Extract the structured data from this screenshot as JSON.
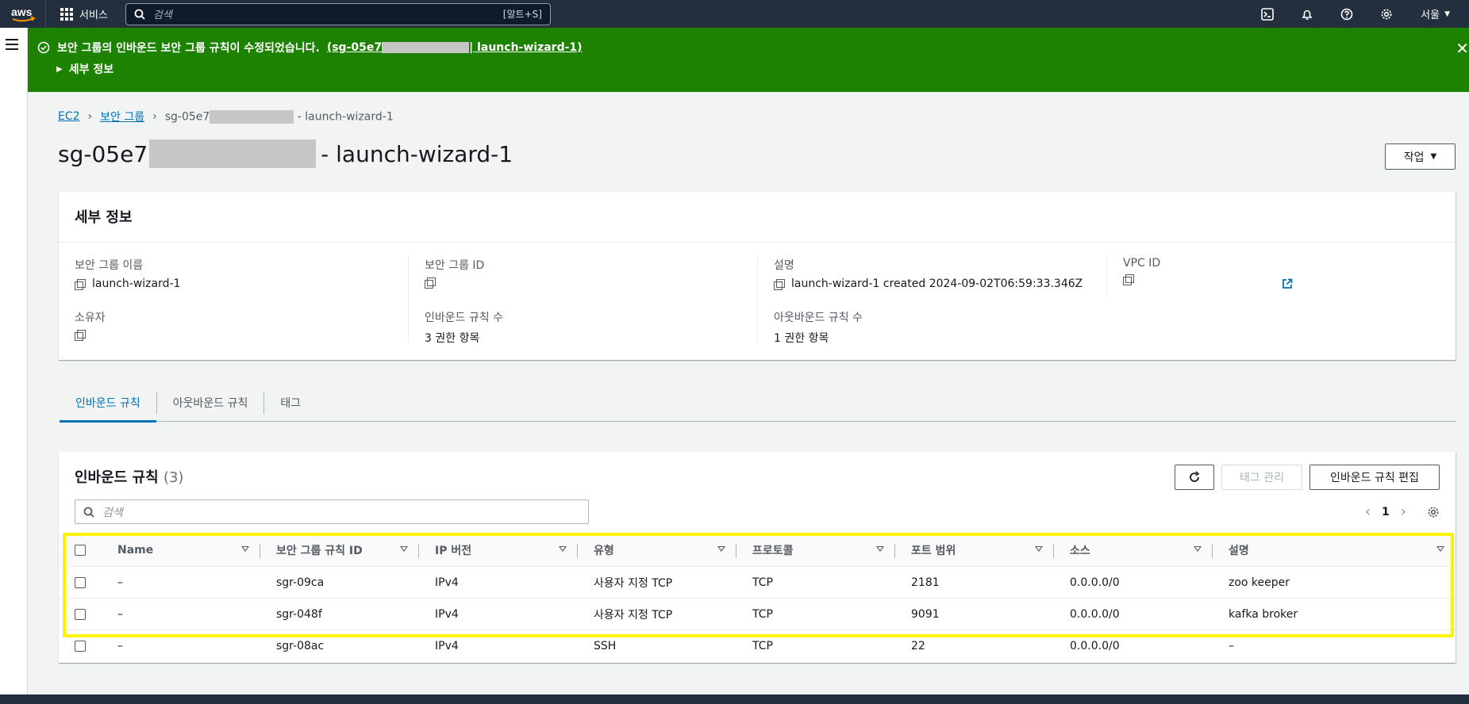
{
  "topnav": {
    "logo_text": "aws",
    "services_label": "서비스",
    "search_placeholder": "검색",
    "search_shortcut": "[알트+S]",
    "region_label": "서울",
    "icons": [
      "cloudshell-icon",
      "bell-icon",
      "help-icon",
      "settings-icon"
    ]
  },
  "flash": {
    "message": "보안 그룹의 인바운드 보안 그룹 규칙이 수정되었습니다.",
    "link_prefix": "(sg-05e7",
    "link_suffix": "| launch-wizard-1)",
    "details_label": "세부 정보",
    "color": "#1d8102"
  },
  "breadcrumb": {
    "items": [
      "EC2",
      "보안 그룹"
    ],
    "current_prefix": "sg-05e7",
    "current_suffix": "- launch-wizard-1"
  },
  "page_title": {
    "prefix": "sg-05e7",
    "suffix": "- launch-wizard-1"
  },
  "action_button": "작업",
  "details": {
    "header": "세부 정보",
    "sg_name_label": "보안 그룹 이름",
    "sg_name_value": "launch-wizard-1",
    "sg_id_label": "보안 그룹 ID",
    "desc_label": "설명",
    "desc_value": "launch-wizard-1 created 2024-09-02T06:59:33.346Z",
    "vpc_label": "VPC ID",
    "owner_label": "소유자",
    "inbound_count_label": "인바운드 규칙 수",
    "inbound_count_value": "3 권한 항목",
    "outbound_count_label": "아웃바운드 규칙 수",
    "outbound_count_value": "1 권한 항목"
  },
  "tabs": [
    {
      "label": "인바운드 규칙",
      "active": true
    },
    {
      "label": "아웃바운드 규칙",
      "active": false
    },
    {
      "label": "태그",
      "active": false
    }
  ],
  "rules": {
    "title": "인바운드 규칙",
    "count": "(3)",
    "manage_tags_label": "태그 관리",
    "edit_rules_label": "인바운드 규칙 편집",
    "search_placeholder": "검색",
    "page": "1",
    "columns": [
      "Name",
      "보안 그룹 규칙 ID",
      "IP 버전",
      "유형",
      "프로토콜",
      "포트 범위",
      "소스",
      "설명"
    ],
    "rows": [
      [
        "–",
        "sgr-09ca",
        "IPv4",
        "사용자 지정 TCP",
        "TCP",
        "2181",
        "0.0.0.0/0",
        "zoo keeper"
      ],
      [
        "–",
        "sgr-048f",
        "IPv4",
        "사용자 지정 TCP",
        "TCP",
        "9091",
        "0.0.0.0/0",
        "kafka broker"
      ],
      [
        "–",
        "sgr-08ac",
        "IPv4",
        "SSH",
        "TCP",
        "22",
        "0.0.0.0/0",
        "–"
      ]
    ],
    "highlight_color": "#fff200"
  }
}
